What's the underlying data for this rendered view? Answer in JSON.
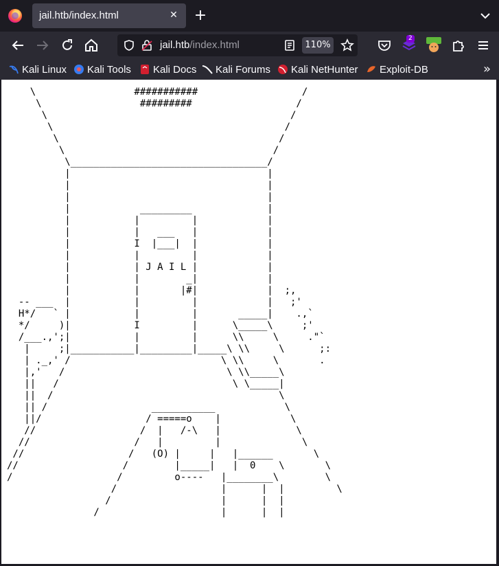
{
  "browser": {
    "tab": {
      "title": "jail.htb/index.html"
    },
    "url": {
      "host": "jail.htb",
      "path": "/index.html"
    },
    "zoom": "110%",
    "extension_badge": "2",
    "bookmarks": [
      {
        "label": "Kali Linux",
        "icon": "kali-icon",
        "color": "#367bf0"
      },
      {
        "label": "Kali Tools",
        "icon": "kali-tools-icon",
        "color": "#e55b5b"
      },
      {
        "label": "Kali Docs",
        "icon": "kali-docs-icon",
        "color": "#d21f2f"
      },
      {
        "label": "Kali Forums",
        "icon": "kali-forums-icon",
        "color": "#fbfbfe"
      },
      {
        "label": "Kali NetHunter",
        "icon": "nethunter-icon",
        "color": "#d21f2f"
      },
      {
        "label": "Exploit-DB",
        "icon": "exploit-db-icon",
        "color": "#e8652a"
      }
    ]
  },
  "page": {
    "ascii_art": "    \\                 ###########                  /\n     \\                 #########                  /\n      \\                                          /\n       \\                                        /\n        \\                                      /\n         \\                                    /\n          \\__________________________________/\n          |                                  |\n          |                                  |\n          |                                  |\n          |            _________             |\n          |           |         |            |\n          |           |   ___   |            |\n          |           I  |___|  |            |\n          |           |         |            |\n          |           | J A I L |            |\n          |           |        _|            |\n          |           |       |#|            |  ;,\n  -- ___  |           |         |            |   ;'\n  H*/   ` |           |         |       _____|    .,`\n  */     )|           I         |      \\_____\\     ;'\n  /___.,';|           |         |      \\\\     \\     .\"`\n   |     ;|___________|_________|_____\\ \\\\     \\      ;:\n   | ._,' /                          \\ \\\\     \\       .\n   |,'   /                            \\ \\\\_____\\\n   ||   /                              \\ \\_____|\n   ||  /                                       \\\n   || /                  ___________            \\\n   ||/                  / =====o    |            \\\n   //                  /  |   /-\\   |             \\\n  //                  /   |         |              \\\n //                  /   (O) |     |   |______       \\\n//                  /        |_____|   |  0    \\       \\\n/                  /         o----   |________\\        \\\n                  /                  |      |  |         \\\n                 /                   |      |  |\n               /                     |      |  |"
  }
}
